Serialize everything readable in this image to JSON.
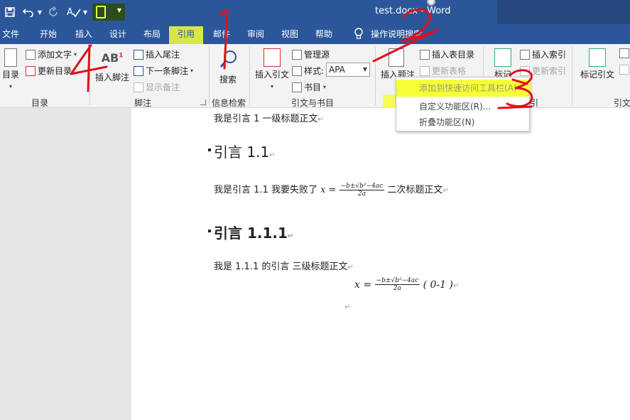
{
  "titlebar": {
    "doc_name": "test.docx",
    "separator": " - ",
    "app_name": "Word",
    "icons": [
      "save-icon",
      "undo-icon",
      "redo-icon",
      "spelling-icon",
      "custom-qa-icon"
    ]
  },
  "tabs": [
    {
      "label": "文件"
    },
    {
      "label": "开始"
    },
    {
      "label": "插入"
    },
    {
      "label": "设计"
    },
    {
      "label": "布局"
    },
    {
      "label": "引用"
    },
    {
      "label": "邮件"
    },
    {
      "label": "审阅"
    },
    {
      "label": "视图"
    },
    {
      "label": "帮助"
    }
  ],
  "search": {
    "label": "操作说明搜索"
  },
  "ribbon": {
    "toc": {
      "big_label": "目录",
      "add_text": "添加文字",
      "update_toc": "更新目录",
      "group": "目录"
    },
    "footnotes": {
      "insert_footnote": "插入脚注",
      "insert_endnote": "插入尾注",
      "next_footnote": "下一条脚注",
      "show_notes": "显示备注",
      "group": "脚注",
      "ab_icon_text": "AB",
      "ab_sup": "1"
    },
    "research": {
      "search": "搜索",
      "group": "信息检索"
    },
    "citations": {
      "insert_citation": "插入引文",
      "manage_sources": "管理源",
      "style_label": "样式:",
      "style_value": "APA",
      "bibliography": "书目",
      "group": "引文与书目"
    },
    "captions": {
      "insert_caption": "插入题注",
      "insert_table_figures": "插入表目录",
      "update_table": "更新表格"
    },
    "index": {
      "mark_entry": "标记",
      "insert_index": "插入索引",
      "update_index": "更新索引",
      "group_partial": "引"
    },
    "toa": {
      "mark_citation": "标记引文",
      "group_partial": "引文"
    }
  },
  "context_menu": [
    {
      "label": "添加到快速访问工具栏(A)",
      "disabled": true
    },
    {
      "label": "自定义功能区(R)..."
    },
    {
      "label": "折叠功能区(N)"
    }
  ],
  "document": {
    "p1": "我是引言 1  一级标题正文",
    "h2": "引言 1.1",
    "p2_pre": "我是引言 1.1  我要失败了",
    "p2_post": "二次标题正文",
    "h3": "引言 1.1.1",
    "p3": "我是 1.1.1 的引言  三级标题正文",
    "eq_label": "( 0-1 )",
    "formula": {
      "lhs": "x =",
      "num": "−b±√b²−4ac",
      "den": "2a"
    },
    "para_mark": "↵"
  },
  "annotations": {
    "n1": "1",
    "n2": "2",
    "n3": "3",
    "n4": "4"
  },
  "colors": {
    "word_blue": "#2b579a",
    "highlight": "#f6ff3a",
    "annotation_red": "#e0101a"
  }
}
